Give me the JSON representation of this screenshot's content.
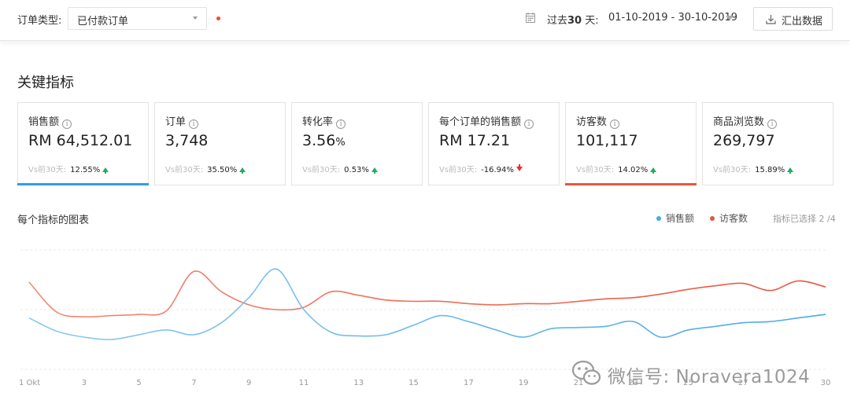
{
  "filter": {
    "order_type_label": "订单类型:",
    "order_type_value": "已付款订单"
  },
  "date_range": {
    "label_prefix": "过去",
    "label_bold": "30",
    "label_suffix": " 天:",
    "value": "01-10-2019 - 30-10-2019"
  },
  "export_label": "汇出数据",
  "section_title": "关键指标",
  "cards": [
    {
      "name": "销售额",
      "value": "RM 64,512.01",
      "unit": "",
      "compare_label": "Vs前30天:",
      "pct": "12.55%",
      "trend": "up",
      "accent": "#2e9ee7"
    },
    {
      "name": "订单",
      "value": "3,748",
      "unit": "",
      "compare_label": "Vs前30天:",
      "pct": "35.50%",
      "trend": "up",
      "accent": ""
    },
    {
      "name": "转化率",
      "value": "3.56",
      "unit": "%",
      "compare_label": "Vs前30天:",
      "pct": "0.53%",
      "trend": "up",
      "accent": ""
    },
    {
      "name": "每个订单的销售额",
      "value": "RM 17.21",
      "unit": "",
      "compare_label": "Vs前30天:",
      "pct": "-16.94%",
      "trend": "down",
      "accent": ""
    },
    {
      "name": "访客数",
      "value": "101,117",
      "unit": "",
      "compare_label": "Vs前30天:",
      "pct": "14.02%",
      "trend": "up",
      "accent": "#e8553d"
    },
    {
      "name": "商品浏览数",
      "value": "269,797",
      "unit": "",
      "compare_label": "Vs前30天:",
      "pct": "15.89%",
      "trend": "up",
      "accent": ""
    }
  ],
  "chart_section": {
    "title": "每个指标的图表",
    "legend": [
      {
        "name": "销售额",
        "color": "#4aa9e9"
      },
      {
        "name": "访客数",
        "color": "#e8553d"
      }
    ],
    "selected_label": "指标已选择 2 /4"
  },
  "chart_data": {
    "type": "line",
    "x": [
      1,
      2,
      3,
      4,
      5,
      6,
      7,
      8,
      9,
      10,
      11,
      12,
      13,
      14,
      15,
      16,
      17,
      18,
      19,
      20,
      21,
      22,
      23,
      24,
      25,
      26,
      27,
      28,
      29,
      30
    ],
    "x_tick_labels": [
      "1 Okt",
      "3",
      "5",
      "7",
      "9",
      "11",
      "13",
      "15",
      "17",
      "19",
      "21",
      "23",
      "25",
      "27",
      "30"
    ],
    "x_tick_positions": [
      1,
      3,
      5,
      7,
      9,
      11,
      13,
      15,
      17,
      19,
      21,
      23,
      25,
      27,
      30
    ],
    "ylim": [
      0,
      100
    ],
    "grid": true,
    "series": [
      {
        "name": "访客数",
        "color": "#f08b78",
        "color_end": "#e8553d",
        "values": [
          73,
          48,
          44,
          45,
          46,
          49,
          82,
          65,
          54,
          50,
          52,
          65,
          62,
          58,
          57,
          57,
          55,
          54,
          55,
          55,
          57,
          59,
          60,
          63,
          67,
          70,
          72,
          66,
          74,
          69
        ]
      },
      {
        "name": "销售额",
        "color": "#8ec9ef",
        "color_end": "#4aa9e9",
        "values": [
          43,
          32,
          27,
          25,
          29,
          33,
          29,
          39,
          60,
          84,
          50,
          31,
          28,
          29,
          37,
          45,
          40,
          33,
          27,
          34,
          35,
          36,
          40,
          27,
          33,
          36,
          39,
          40,
          43,
          46
        ]
      }
    ]
  },
  "watermark": {
    "text": "微信号: Noravera1024"
  }
}
